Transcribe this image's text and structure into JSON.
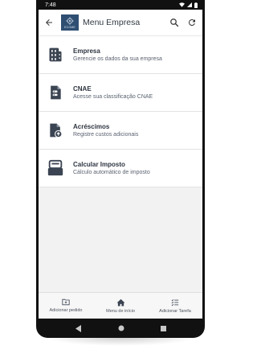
{
  "status_bar": {
    "time": "7:48"
  },
  "app_bar": {
    "title": "Menu Empresa",
    "logo_text": "ECGME",
    "back_icon": "arrow-left-icon",
    "search_icon": "search-icon",
    "refresh_icon": "refresh-icon"
  },
  "menu": {
    "items": [
      {
        "title": "Empresa",
        "subtitle": "Gerencie os dados da sua empresa",
        "icon": "building-icon"
      },
      {
        "title": "CNAE",
        "subtitle": "Acesse sua classificação CNAE",
        "icon": "document-icon"
      },
      {
        "title": "Acréscimos",
        "subtitle": "Registre custos adicionais",
        "icon": "file-upload-icon"
      },
      {
        "title": "Calcular Imposto",
        "subtitle": "Cálculo automático de imposto",
        "icon": "tax-icon"
      }
    ]
  },
  "bottom_nav": {
    "items": [
      {
        "label": "Adicionar pedido",
        "icon": "folder-add-icon"
      },
      {
        "label": "Menu de início",
        "icon": "home-icon"
      },
      {
        "label": "Adicionar Tarefa",
        "icon": "checklist-icon"
      }
    ]
  },
  "colors": {
    "primary": "#2f4f72",
    "icon": "#3b4452",
    "background": "#f2f2f2"
  }
}
